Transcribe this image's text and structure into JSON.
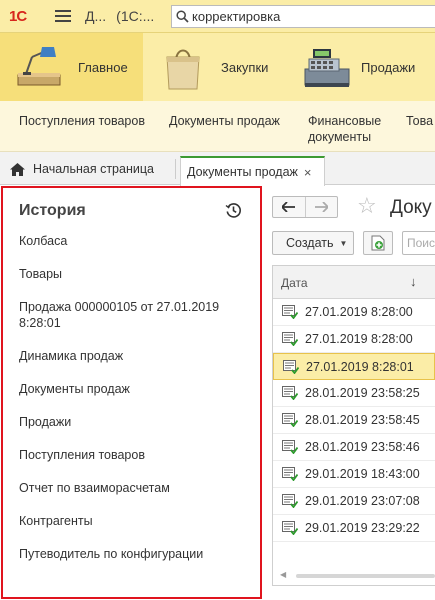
{
  "titlebar": {
    "logo": "1С",
    "app_title_short": "Д...",
    "app_title_mid": "(1С:...",
    "search_value": "корректировка"
  },
  "sections": [
    {
      "label": "Главное",
      "icon": "desk-lamp-icon",
      "active": true
    },
    {
      "label": "Закупки",
      "icon": "shopping-bag-icon",
      "active": false
    },
    {
      "label": "Продажи",
      "icon": "cash-register-icon",
      "active": false
    }
  ],
  "subnav": {
    "items": [
      {
        "label": "Поступления товаров"
      },
      {
        "label": "Документы продаж"
      },
      {
        "label": "Финансовые\nдокументы"
      },
      {
        "label": "Това"
      }
    ]
  },
  "tabs": {
    "home_label": "Начальная страница",
    "active_label": "Документы продаж",
    "close": "×"
  },
  "history": {
    "title": "История",
    "items": [
      "Колбаса",
      "Товары",
      "Продажа 000000105 от 27.01.2019 8:28:01",
      "Динамика продаж",
      "Документы продаж",
      "Продажи",
      "Поступления товаров",
      "Отчет по взаиморасчетам",
      "Контрагенты",
      "Путеводитель по конфигурации"
    ]
  },
  "document_list": {
    "title": "Доку",
    "create_label": "Создать",
    "search_placeholder": "Поис",
    "column_date": "Дата",
    "sort_indicator": "↓",
    "rows": [
      {
        "date": "27.01.2019 8:28:00",
        "selected": false
      },
      {
        "date": "27.01.2019 8:28:00",
        "selected": false
      },
      {
        "date": "27.01.2019 8:28:01",
        "selected": true
      },
      {
        "date": "28.01.2019 23:58:25",
        "selected": false
      },
      {
        "date": "28.01.2019 23:58:45",
        "selected": false
      },
      {
        "date": "28.01.2019 23:58:46",
        "selected": false
      },
      {
        "date": "29.01.2019 18:43:00",
        "selected": false
      },
      {
        "date": "29.01.2019 23:07:08",
        "selected": false
      },
      {
        "date": "29.01.2019 23:29:22",
        "selected": false
      }
    ]
  },
  "colors": {
    "panel_yellow": "#fbeda7",
    "active_section": "#f6df7a",
    "highlight_border": "#e0141e",
    "active_tab_accent": "#3c9a33",
    "selected_row": "#fbeda7"
  }
}
